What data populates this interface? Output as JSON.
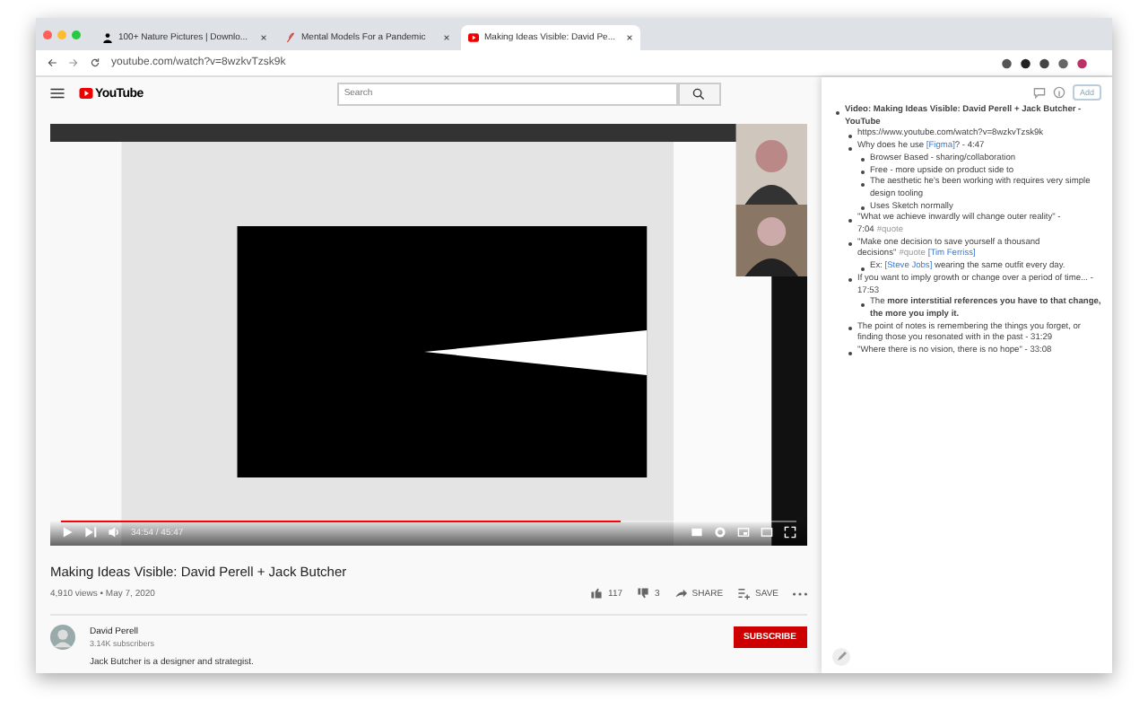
{
  "browser": {
    "tabs": [
      {
        "title": "100+ Nature Pictures | Downlo...",
        "selected": false
      },
      {
        "title": "Mental Models For a Pandemic",
        "selected": false
      },
      {
        "title": "Making Ideas Visible: David Pe...",
        "selected": true
      }
    ],
    "url": "youtube.com/watch?v=8wzkvTzsk9k"
  },
  "youtube": {
    "logo": "YouTube",
    "search": {
      "placeholder": "Search"
    },
    "video": {
      "kind": "picture",
      "time": "34:54 / 45:47",
      "level": 0.76
    },
    "title": "Making Ideas Visible: David Perell + Jack Butcher",
    "meta": "4,910 views • May 7, 2020",
    "likes": "117",
    "dislikes": "3",
    "share": "SHARE",
    "save": "SAVE",
    "channel": {
      "name": "David Perell",
      "subscribers": "3.14K subscribers"
    },
    "subscribe": "SUBSCRIBE",
    "description": "Jack Butcher is a designer and strategist."
  },
  "notes": {
    "button": "Add",
    "items": [
      {
        "parts": [
          {
            "kind": "text",
            "text": "**Video: Making Ideas Visible: David Perell + Jack Butcher - YouTube**"
          }
        ],
        "children": [
          {
            "parts": [
              {
                "kind": "text",
                "text": "https://www.youtube.com/watch?v=8wzkvTzsk9k"
              }
            ]
          },
          {
            "parts": [
              {
                "kind": "text",
                "text": "Why does he use "
              },
              {
                "kind": "link",
                "text": "[Figma]"
              },
              {
                "kind": "text",
                "text": "? - 4:47"
              }
            ],
            "children": [
              {
                "parts": [
                  {
                    "kind": "text",
                    "text": "Browser Based - sharing/collaboration"
                  }
                ]
              },
              {
                "parts": [
                  {
                    "kind": "text",
                    "text": "Free - more upside on product side to"
                  }
                ]
              },
              {
                "parts": [
                  {
                    "kind": "text",
                    "text": "The aesthetic he's been working with requires very simple design tooling"
                  }
                ]
              },
              {
                "parts": [
                  {
                    "kind": "text",
                    "text": "Uses Sketch normally"
                  }
                ]
              }
            ]
          },
          {
            "parts": [
              {
                "kind": "text",
                "text": "\"What we achieve inwardly will change outer reality\" - 7:04"
              },
              {
                "kind": "tag",
                "text": "#quote"
              }
            ]
          },
          {
            "parts": [
              {
                "kind": "text",
                "text": "\"Make one decision to save yourself a thousand decisions\""
              },
              {
                "kind": "tag",
                "text": "#quote"
              },
              {
                "kind": "link",
                "text": "[Tim Ferriss]"
              }
            ],
            "children": [
              {
                "parts": [
                  {
                    "kind": "text",
                    "text": "Ex: "
                  },
                  {
                    "kind": "link",
                    "text": "[Steve Jobs]"
                  },
                  {
                    "kind": "text",
                    "text": " wearing the same outfit every day."
                  }
                ]
              }
            ]
          },
          {
            "parts": [
              {
                "kind": "text",
                "text": "If you want to imply growth or change over a period of time... - 17:53"
              }
            ],
            "children": [
              {
                "parts": [
                  {
                    "kind": "text",
                    "text": "The **more interstitial references you have to that change, the more you imply it.**"
                  }
                ]
              }
            ]
          },
          {
            "parts": [
              {
                "kind": "text",
                "text": "The point of notes is remembering the things you forget, or finding those you resonated with in the past - 31:29"
              }
            ]
          },
          {
            "parts": [
              {
                "kind": "text",
                "text": "\"Where there is no vision, there is no hope\" - 33:08"
              }
            ]
          }
        ]
      }
    ]
  }
}
